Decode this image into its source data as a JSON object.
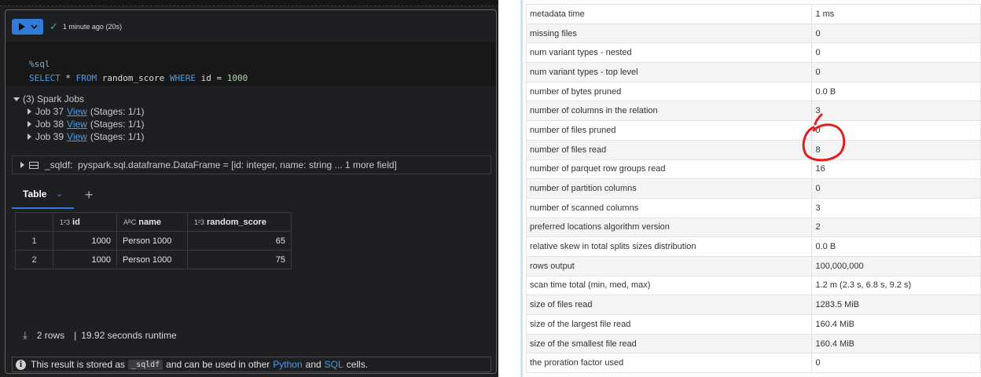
{
  "cell": {
    "status_text": "1 minute ago (20s)",
    "code_lines": {
      "magic": "%sql",
      "kw_select": "SELECT",
      "star": "*",
      "kw_from": "FROM",
      "table": "random_score",
      "kw_where": "WHERE",
      "col": "id",
      "op": "=",
      "value": "1000"
    }
  },
  "spark_jobs": {
    "header": "(3) Spark Jobs",
    "jobs": [
      {
        "name": "Job 37",
        "link": "View",
        "stages": "(Stages: 1/1)"
      },
      {
        "name": "Job 38",
        "link": "View",
        "stages": "(Stages: 1/1)"
      },
      {
        "name": "Job 39",
        "link": "View",
        "stages": "(Stages: 1/1)"
      }
    ]
  },
  "dataframe": {
    "label": "_sqldf:",
    "type_text": "pyspark.sql.dataframe.DataFrame = [id: integer, name: string ... 1 more field]"
  },
  "result_tabs": {
    "active": "Table",
    "chevron": "⌄",
    "add": "+"
  },
  "result_table": {
    "columns": [
      {
        "type_icon": "1²3",
        "name": "id"
      },
      {
        "type_icon": "AᴮC",
        "name": "name"
      },
      {
        "type_icon": "1²3",
        "name": "random_score"
      }
    ],
    "rows": [
      {
        "index": "1",
        "id": "1000",
        "name": "Person 1000",
        "random_score": "65"
      },
      {
        "index": "2",
        "id": "1000",
        "name": "Person 1000",
        "random_score": "75"
      }
    ]
  },
  "footer": {
    "rows": "2 rows",
    "separator": "|",
    "runtime": "19.92 seconds runtime"
  },
  "info_bar": {
    "pre": "This result is stored as",
    "code": "_sqldf",
    "mid": "and can be used in other",
    "python": "Python",
    "and": "and",
    "sql": "SQL",
    "post": "cells."
  },
  "metrics": [
    {
      "key": "metadata time",
      "value": "1 ms"
    },
    {
      "key": "missing files",
      "value": "0"
    },
    {
      "key": "num variant types - nested",
      "value": "0"
    },
    {
      "key": "num variant types - top level",
      "value": "0"
    },
    {
      "key": "number of bytes pruned",
      "value": "0.0 B"
    },
    {
      "key": "number of columns in the relation",
      "value": "3"
    },
    {
      "key": "number of files pruned",
      "value": "0"
    },
    {
      "key": "number of files read",
      "value": "8"
    },
    {
      "key": "number of parquet row groups read",
      "value": "16"
    },
    {
      "key": "number of partition columns",
      "value": "0"
    },
    {
      "key": "number of scanned columns",
      "value": "3"
    },
    {
      "key": "preferred locations algorithm version",
      "value": "2"
    },
    {
      "key": "relative skew in total splits sizes distribution",
      "value": "0.0 B"
    },
    {
      "key": "rows output",
      "value": "100,000,000"
    },
    {
      "key": "scan time total (min, med, max)",
      "value": "1.2 m (2.3 s, 6.8 s, 9.2 s)"
    },
    {
      "key": "size of files read",
      "value": "1283.5 MiB"
    },
    {
      "key": "size of the largest file read",
      "value": "160.4 MiB"
    },
    {
      "key": "size of the smallest file read",
      "value": "160.4 MiB"
    },
    {
      "key": "the proration factor used",
      "value": "0"
    }
  ],
  "colors": {
    "accent": "#2f7bd8",
    "link": "#4c9be8",
    "annotation": "#e02020"
  }
}
